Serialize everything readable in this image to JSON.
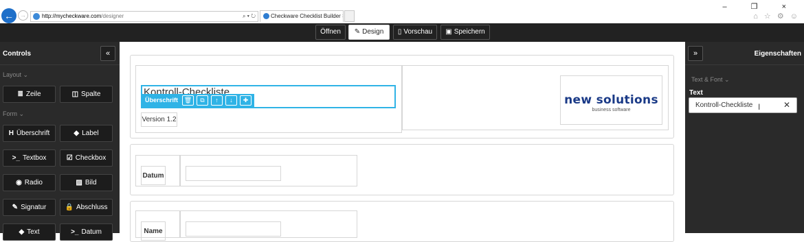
{
  "browser": {
    "address_host": "http://mycheckware.com",
    "address_path": "/designer",
    "address_icons": "⌕ ▾ ↻",
    "tab_title": "Checkware Checklist Builder",
    "tab_close": "×",
    "window_controls": "– ❐ ×",
    "browser_icons": "⌂ ☆ ⚙ ☺",
    "back_glyph": "←",
    "forward_glyph": "→"
  },
  "toolbar": {
    "open_label": "Öffnen",
    "design_label": "Design",
    "preview_label": "Vorschau",
    "save_label": "Speichern",
    "design_icon": "✎",
    "preview_icon": "▯",
    "save_icon": "▣",
    "active_tab": "Design"
  },
  "sidebar": {
    "title": "Controls",
    "collapse_glyph": "«",
    "layout_section": "Layout ⌄",
    "form_section": "Form ⌄",
    "items": [
      {
        "icon": "≣",
        "label": "Zeile",
        "icon_name": "rows-icon"
      },
      {
        "icon": "◫",
        "label": "Spalte",
        "icon_name": "columns-icon"
      },
      {
        "icon": "H",
        "label": "Überschrift",
        "icon_name": "heading-icon"
      },
      {
        "icon": "◆",
        "label": "Label",
        "icon_name": "tag-icon"
      },
      {
        "icon": ">_",
        "label": "Textbox",
        "icon_name": "terminal-icon"
      },
      {
        "icon": "☑",
        "label": "Checkbox",
        "icon_name": "checkbox-icon"
      },
      {
        "icon": "◉",
        "label": "Radio",
        "icon_name": "radio-icon"
      },
      {
        "icon": "▨",
        "label": "Bild",
        "icon_name": "image-icon"
      },
      {
        "icon": "✎",
        "label": "Signatur",
        "icon_name": "edit-icon"
      },
      {
        "icon": "🔒",
        "label": "Abschluss",
        "icon_name": "lock-icon"
      },
      {
        "icon": "◆",
        "label": "Text",
        "icon_name": "text-tag-icon"
      },
      {
        "icon": ">_",
        "label": "Datum",
        "icon_name": "date-terminal-icon"
      }
    ]
  },
  "canvas": {
    "heading_text": "Kontroll-Checkliste",
    "edit_toolbar": {
      "label": "Überschrift",
      "buttons": [
        "🗑",
        "⧉",
        "↑",
        "↓",
        "✚"
      ]
    },
    "version_label": "Version 1.2",
    "logo_main": "new solutions",
    "logo_sub": "business software",
    "date_label": "Datum",
    "name_label": "Name"
  },
  "properties": {
    "expand_glyph": "»",
    "title": "Eigenschaften",
    "section": "Text & Font ⌄",
    "field_label": "Text",
    "field_value": "Kontroll-Checkliste",
    "clear_glyph": "✕"
  }
}
